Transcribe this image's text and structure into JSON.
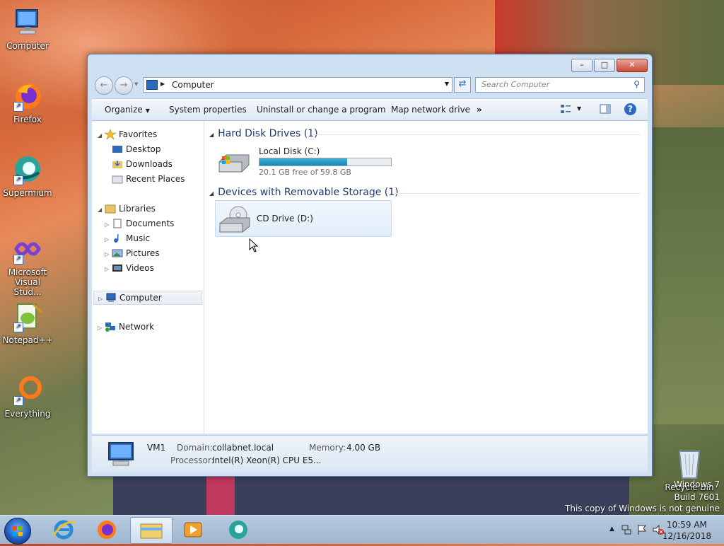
{
  "desktop": {
    "icons": [
      {
        "label": "Computer",
        "icon": "computer-icon"
      },
      {
        "label": "Firefox",
        "icon": "firefox-icon"
      },
      {
        "label": "Supermium",
        "icon": "supermium-icon"
      },
      {
        "label": "Microsoft Visual Stud...",
        "icon": "visual-studio-icon"
      },
      {
        "label": "Notepad++",
        "icon": "notepad-plus-plus-icon"
      },
      {
        "label": "Everything",
        "icon": "everything-search-icon"
      }
    ],
    "recycle_bin": {
      "label": "Recycle Bin",
      "icon": "recycle-bin-icon"
    },
    "watermark": {
      "line1": "Windows 7",
      "line2": "Build 7601",
      "line3": "This copy of Windows is not genuine"
    }
  },
  "window": {
    "address_path": "Computer",
    "search_placeholder": "Search Computer",
    "caption": {
      "minimize": "–",
      "maximize": "□",
      "close": "✕"
    },
    "toolbar": {
      "organize": "Organize",
      "system_properties": "System properties",
      "uninstall": "Uninstall or change a program",
      "map_drive": "Map network drive",
      "more": "»",
      "help": "?"
    },
    "nav_pane": {
      "favorites": {
        "label": "Favorites",
        "items": [
          "Desktop",
          "Downloads",
          "Recent Places"
        ]
      },
      "libraries": {
        "label": "Libraries",
        "items": [
          "Documents",
          "Music",
          "Pictures",
          "Videos"
        ]
      },
      "computer": "Computer",
      "network": "Network"
    },
    "groups": {
      "hard_disks": {
        "header": "Hard Disk Drives (1)",
        "drives": [
          {
            "name": "Local Disk (C:)",
            "free_text": "20.1 GB free of 59.8 GB",
            "used_fraction": 0.664
          }
        ]
      },
      "removable": {
        "header": "Devices with Removable Storage (1)",
        "drives": [
          {
            "name": "CD Drive (D:)"
          }
        ]
      }
    },
    "details": {
      "computer_name": "VM1",
      "domain_label": "Domain:",
      "domain_value": "collabnet.local",
      "memory_label": "Memory:",
      "memory_value": "4.00 GB",
      "processor_label": "Processor:",
      "processor_value": "Intel(R) Xeon(R) CPU E5..."
    }
  },
  "taskbar": {
    "pinned": [
      "internet-explorer-icon",
      "firefox-icon",
      "windows-explorer-icon",
      "media-player-icon",
      "supermium-icon"
    ],
    "clock": {
      "time": "10:59 AM",
      "date": "12/16/2018"
    }
  },
  "colors": {
    "accent": "#2f6bc4",
    "drive_bar": "#1b86b6",
    "group_header": "#1e3a6e"
  }
}
